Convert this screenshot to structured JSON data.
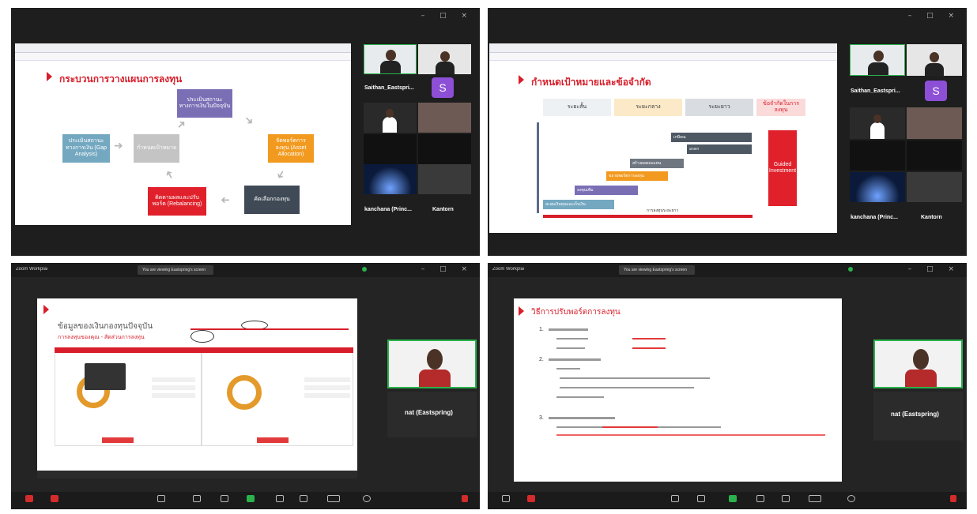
{
  "q1": {
    "slide_title": "กระบวนการวางแผนการลงทุน",
    "boxes": [
      {
        "label": "ประเมินสถานะทางการเงินในปัจจุบัน"
      },
      {
        "label": "กำหนดเป้าหมาย"
      },
      {
        "label": "ประเมินสถานะทางการเงิน (Gap Analysis)"
      },
      {
        "label": "จัดพอร์ตการลงทุน (Asset Allocation)"
      },
      {
        "label": "ติดตามผลและปรับพอร์ต (Rebalancing)"
      },
      {
        "label": "คัดเลือกกองทุน"
      }
    ],
    "participants": [
      {
        "name": "Saithan_Eastspri..."
      },
      {
        "name": "kanchana (Princ..."
      },
      {
        "name": "Kantorn"
      }
    ],
    "avatar_letter": "S"
  },
  "q2": {
    "slide_title": "กำหนดเป้าหมายและข้อจำกัด",
    "headers": [
      "ระยะสั้น",
      "ระยะกลาง",
      "ระยะยาว",
      "ข้อจำกัดในการลงทุน"
    ],
    "steps": [
      "สะสมเงินทุนและเก็บเงิน",
      "ลงทุนเพิ่ม",
      "ขยายพอร์ตการลงทุน",
      "สร้างผลตอบแทน",
      "เกษียณ",
      "มรดก",
      "การลงทุนระยะยาว"
    ],
    "redbox": "Guided Investment",
    "participants": [
      {
        "name": "Saithan_Eastspri..."
      },
      {
        "name": "kanchana (Princ..."
      },
      {
        "name": "Kantorn"
      }
    ],
    "avatar_letter": "S"
  },
  "q3": {
    "app": "Zoom Workplace",
    "share_tab": "You are viewing Eastspring's screen",
    "slide_title": "ข้อมูลของเงินกองทุนปัจจุบัน",
    "slide_subtitle": "การลงทุนของคุณ - สัดส่วนการลงทุน",
    "speaker_name": "nat (Eastspring)"
  },
  "q4": {
    "app": "Zoom Workplace",
    "share_tab": "You are viewing Eastspring's screen",
    "slide_title": "วิธีการปรับพอร์ตการลงทุน",
    "items": [
      "1.",
      "2.",
      "3."
    ],
    "speaker_name": "nat (Eastspring)"
  },
  "colors": {
    "brand_red": "#d81e2a",
    "purple_box": "#7a6fb5",
    "orange_box": "#f29a1f",
    "teal_box": "#74a8c1",
    "grey_box": "#c4c4c4",
    "dark_box": "#3f4a56",
    "zoom_green": "#2bb24c"
  }
}
